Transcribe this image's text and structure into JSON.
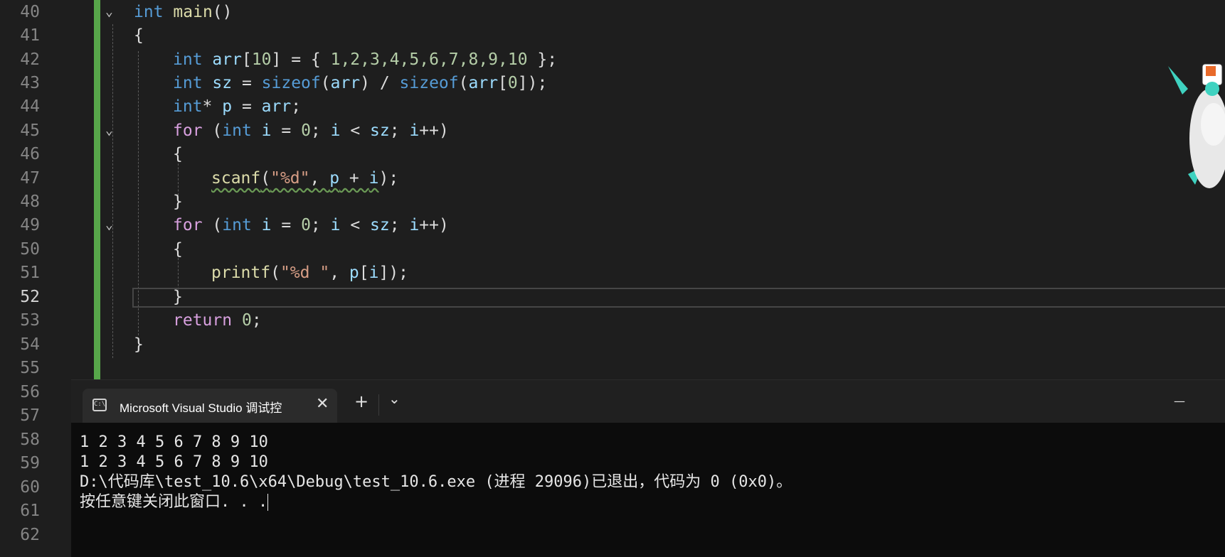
{
  "editor": {
    "line_numbers": [
      "40",
      "41",
      "42",
      "43",
      "44",
      "45",
      "46",
      "47",
      "48",
      "49",
      "50",
      "51",
      "52",
      "53",
      "54",
      "55",
      "56",
      "57",
      "58",
      "59",
      "60",
      "61",
      "62"
    ],
    "current_line": "52",
    "code": {
      "l40": {
        "kw": "int",
        "fn": "main",
        "rest": "()"
      },
      "l41": "{",
      "l42": {
        "kw": "int",
        "var": "arr",
        "p1": "[",
        "n1": "10",
        "p2": "] = { ",
        "nums": "1,2,3,4,5,6,7,8,9,10",
        "p3": " };"
      },
      "l43": {
        "kw": "int",
        "var": "sz",
        "p1": " = ",
        "fn1": "sizeof",
        "p2": "(",
        "v2": "arr",
        "p3": ") / ",
        "fn2": "sizeof",
        "p4": "(",
        "v3": "arr",
        "p5": "[",
        "n": "0",
        "p6": "]);"
      },
      "l44": {
        "kw": "int",
        "p1": "* ",
        "var": "p",
        "p2": " = ",
        "v2": "arr",
        "p3": ";"
      },
      "l45": {
        "ctrl": "for",
        "p1": " (",
        "kw": "int",
        "p2": " ",
        "v1": "i",
        "p3": " = ",
        "n": "0",
        "p4": "; ",
        "v2": "i",
        "p5": " < ",
        "v3": "sz",
        "p6": "; ",
        "v4": "i",
        "p7": "++)"
      },
      "l46": "{",
      "l47": {
        "fn": "scanf",
        "p1": "(",
        "str": "\"%d\"",
        "p2": ", ",
        "v1": "p",
        "p3": " + ",
        "v2": "i",
        "p4": ");"
      },
      "l48": "}",
      "l49": {
        "ctrl": "for",
        "p1": " (",
        "kw": "int",
        "p2": " ",
        "v1": "i",
        "p3": " = ",
        "n": "0",
        "p4": "; ",
        "v2": "i",
        "p5": " < ",
        "v3": "sz",
        "p6": "; ",
        "v4": "i",
        "p7": "++)"
      },
      "l50": "{",
      "l51": {
        "fn": "printf",
        "p1": "(",
        "str": "\"%d \"",
        "p2": ", ",
        "v1": "p",
        "p3": "[",
        "v2": "i",
        "p4": "]);"
      },
      "l52": "}",
      "l53": {
        "ctrl": "return",
        "p1": " ",
        "n": "0",
        "p2": ";"
      },
      "l54": "}"
    }
  },
  "terminal": {
    "tab_title": "Microsoft Visual Studio 调试控",
    "tab_close": "✕",
    "new_tab": "+",
    "dropdown": "⌄",
    "minimize": "—",
    "output_lines": [
      "1 2 3 4 5 6 7 8 9 10",
      "1 2 3 4 5 6 7 8 9 10",
      "D:\\代码库\\test_10.6\\x64\\Debug\\test_10.6.exe (进程 29096)已退出，代码为 0 (0x0)。",
      "按任意键关闭此窗口. . ."
    ]
  },
  "colors": {
    "background": "#1e1e1e",
    "keyword": "#569cd6",
    "control": "#d8a0df",
    "function": "#dcdcaa",
    "variable": "#9cdcfe",
    "number": "#b5cea8",
    "string": "#d69d85",
    "change_bar": "#57a64a"
  }
}
